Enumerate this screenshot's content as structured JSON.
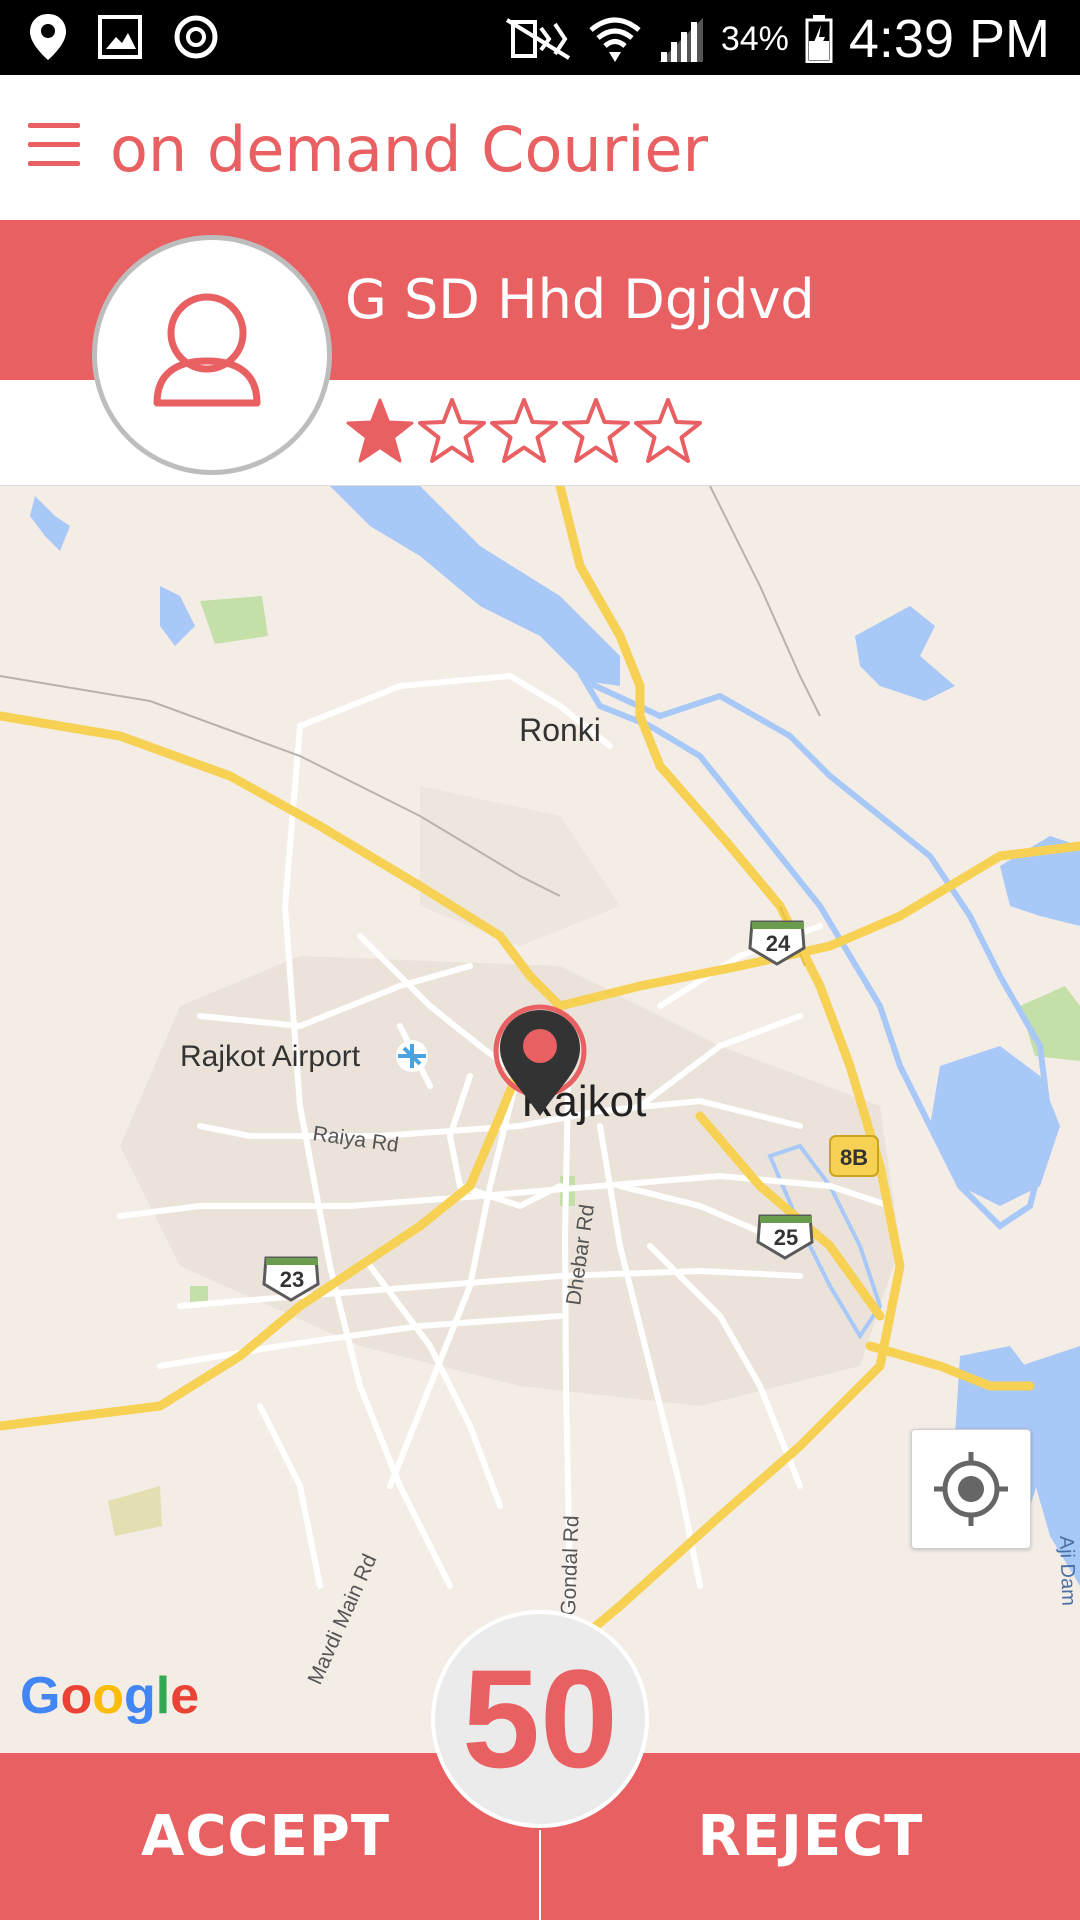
{
  "status_bar": {
    "battery": "34%",
    "time": "4:39 PM",
    "icons": [
      "location-icon",
      "image-icon",
      "sync-icon",
      "mute-icon",
      "wifi-icon",
      "signal-icon",
      "battery-icon"
    ]
  },
  "app_bar": {
    "title": "on demand Courier",
    "menu_icon": "hamburger-menu-icon"
  },
  "customer": {
    "name": "G SD Hhd Dgjdvd",
    "rating": 1,
    "rating_max": 5,
    "avatar_icon": "person-icon"
  },
  "map": {
    "labels": {
      "ronki": "Ronki",
      "airport": "Rajkot Airport",
      "city": "Rajkot",
      "raiya": "Raiya Rd",
      "dhebar": "Dhebar Rd",
      "gondal": "Gondal Rd",
      "mavdi": "Mavdi Main Rd",
      "aji": "Aji Dam"
    },
    "shields": {
      "h24": "24",
      "h8b": "8B",
      "h25": "25",
      "h23": "23"
    },
    "attribution": "Google",
    "locate_icon": "my-location-icon",
    "marker_icon": "map-pin-icon",
    "colors": {
      "land": "#f3ede6",
      "water": "#a8c8f8",
      "highway": "#f7d154",
      "road": "#ffffff",
      "park": "#c5dfa8"
    }
  },
  "countdown": "50",
  "actions": {
    "accept": "ACCEPT",
    "reject": "REJECT"
  },
  "colors": {
    "accent": "#e96063"
  }
}
